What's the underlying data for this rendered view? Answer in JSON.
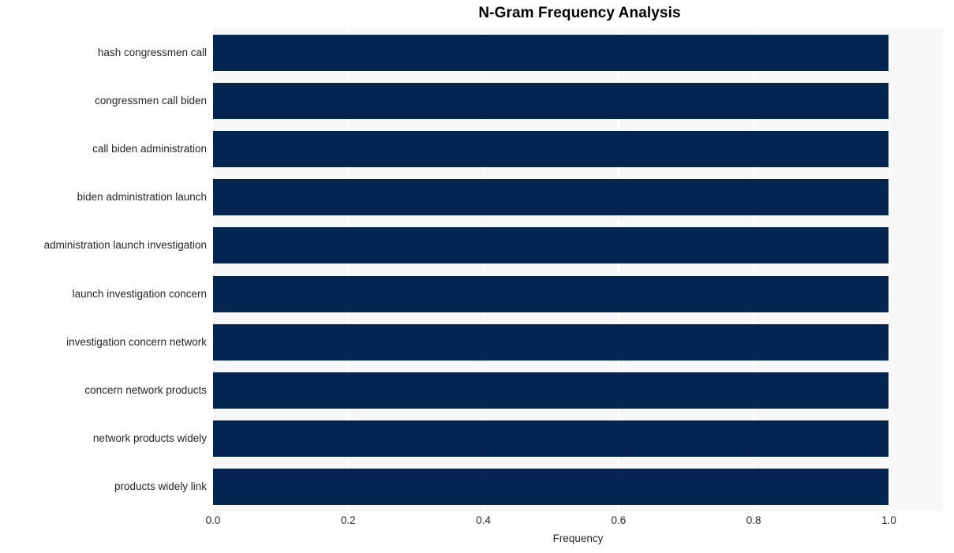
{
  "chart_data": {
    "type": "bar",
    "orientation": "horizontal",
    "title": "N-Gram Frequency Analysis",
    "xlabel": "Frequency",
    "ylabel": "",
    "categories": [
      "hash congressmen call",
      "congressmen call biden",
      "call biden administration",
      "biden administration launch",
      "administration launch investigation",
      "launch investigation concern",
      "investigation concern network",
      "concern network products",
      "network products widely",
      "products widely link"
    ],
    "values": [
      1.0,
      1.0,
      1.0,
      1.0,
      1.0,
      1.0,
      1.0,
      1.0,
      1.0,
      1.0
    ],
    "xlim": [
      0.0,
      1.08
    ],
    "xticks": [
      "0.0",
      "0.2",
      "0.4",
      "0.6",
      "0.8",
      "1.0"
    ],
    "xtick_values": [
      0.0,
      0.2,
      0.4,
      0.6,
      0.8,
      1.0
    ],
    "grid": "vertical-white-on-gray",
    "legend": "none",
    "colors": {
      "bar": "#04254f",
      "plot_background": "#f7f7f7",
      "figure_background": "#ffffff",
      "gridline": "#ffffff",
      "text": "#262626",
      "title": "#000000"
    }
  }
}
